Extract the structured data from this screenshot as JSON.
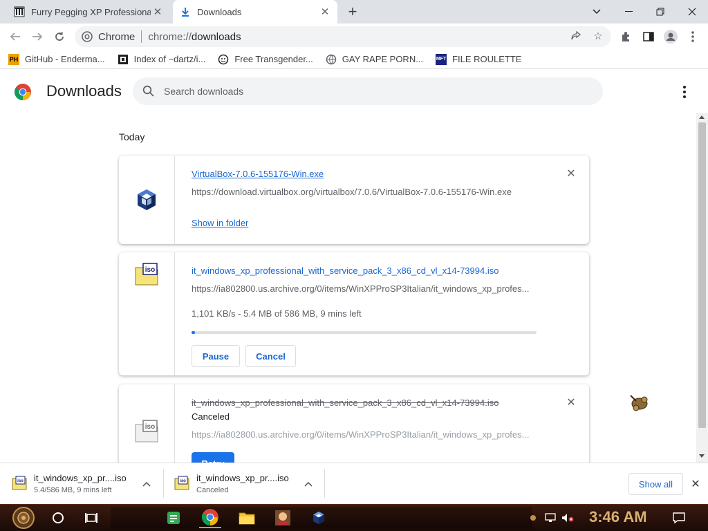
{
  "tabs": [
    {
      "title": "Furry Pegging XP Professional S",
      "favicon": "library-icon"
    },
    {
      "title": "Downloads",
      "favicon": "download-icon"
    }
  ],
  "omnibox": {
    "site_label": "Chrome",
    "url_scheme": "chrome://",
    "url_path": "downloads"
  },
  "bookmarks": [
    {
      "label": "GitHub - Enderma...",
      "icon": "ph-icon",
      "color": "#f0a000"
    },
    {
      "label": "Index of ~dartz/i...",
      "icon": "film-icon",
      "color": "#202124"
    },
    {
      "label": "Free Transgender...",
      "icon": "face-icon",
      "color": "#202124"
    },
    {
      "label": "GAY RAPE PORN...",
      "icon": "globe-icon",
      "color": "#202124"
    },
    {
      "label": "FILE ROULETTE",
      "icon": "roulette-icon",
      "color": "#1a237e"
    }
  ],
  "page": {
    "title": "Downloads",
    "search_placeholder": "Search downloads",
    "day_label": "Today"
  },
  "downloads": [
    {
      "name": "VirtualBox-7.0.6-155176-Win.exe",
      "url": "https://download.virtualbox.org/virtualbox/7.0.6/VirtualBox-7.0.6-155176-Win.exe",
      "action": "Show in folder",
      "state": "complete",
      "icon": "virtualbox-icon"
    },
    {
      "name": "it_windows_xp_professional_with_service_pack_3_x86_cd_vl_x14-73994.iso",
      "url": "https://ia802800.us.archive.org/0/items/WinXPProSP3Italian/it_windows_xp_profes...",
      "status": "1,101 KB/s - 5.4 MB of 586 MB, 9 mins left",
      "progress": 0.0092,
      "pause_label": "Pause",
      "cancel_label": "Cancel",
      "state": "in_progress",
      "icon": "iso-icon"
    },
    {
      "name": "it_windows_xp_professional_with_service_pack_3_x86_cd_vl_x14-73994.iso",
      "status": "Canceled",
      "url": "https://ia802800.us.archive.org/0/items/WinXPProSP3Italian/it_windows_xp_profes...",
      "retry_label": "Retry",
      "state": "canceled",
      "icon": "iso-icon"
    }
  ],
  "shelf": {
    "items": [
      {
        "name": "it_windows_xp_pr....iso",
        "status": "5.4/586 MB, 9 mins left"
      },
      {
        "name": "it_windows_xp_pr....iso",
        "status": "Canceled"
      }
    ],
    "show_all_label": "Show all"
  },
  "taskbar": {
    "clock": "3:46 AM"
  },
  "colors": {
    "accent": "#1a73e8",
    "link": "#1967d2",
    "tabstrip": "#dee1e6"
  }
}
